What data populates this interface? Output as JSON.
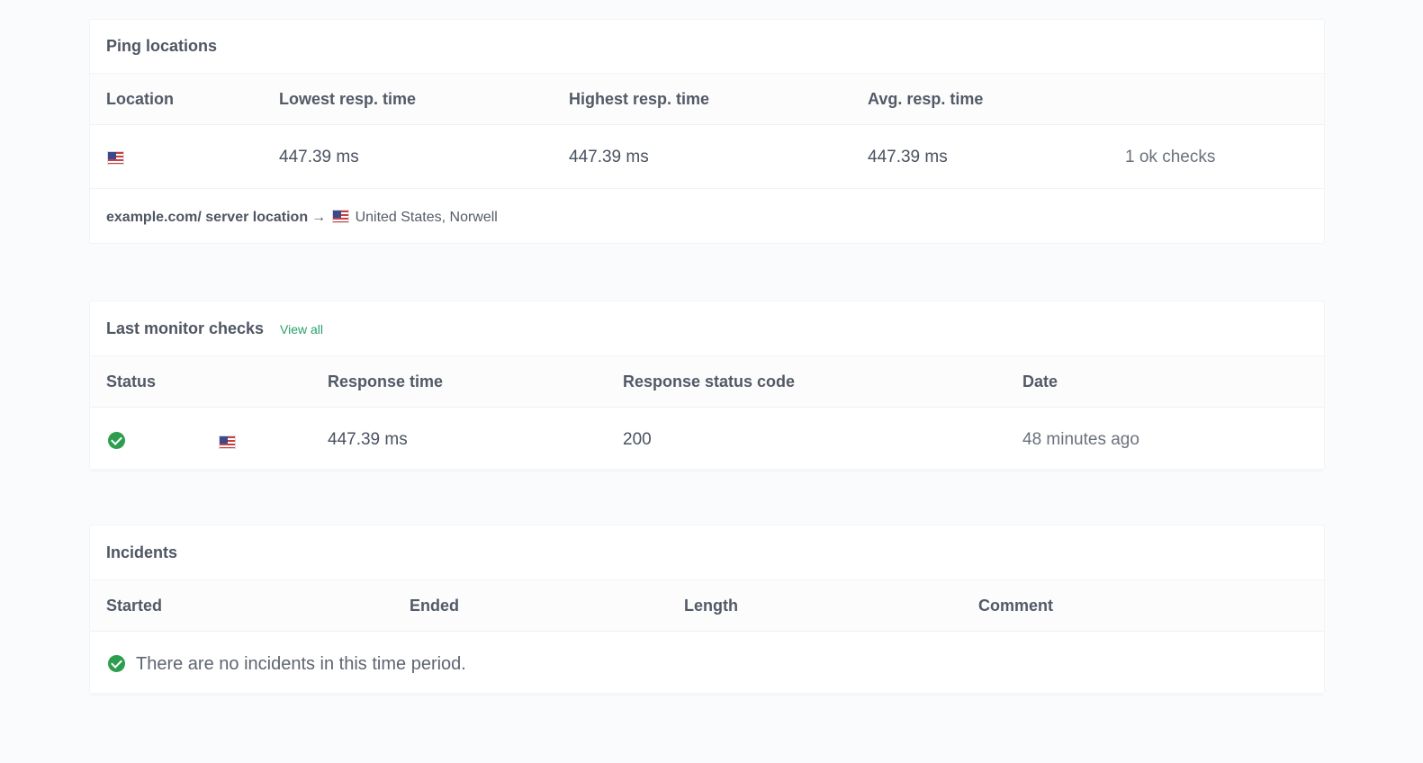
{
  "ping_locations": {
    "title": "Ping locations",
    "columns": [
      "Location",
      "Lowest resp. time",
      "Highest resp. time",
      "Avg. resp. time"
    ],
    "rows": [
      {
        "location_icon": "us-flag-icon",
        "lowest": "447.39 ms",
        "highest": "447.39 ms",
        "avg": "447.39 ms",
        "checks": "1 ok checks"
      }
    ],
    "server_label": "example.com/ server location",
    "arrow": "→",
    "server_location": "United States, Norwell"
  },
  "last_checks": {
    "title": "Last monitor checks",
    "view_all": "View all",
    "columns": [
      "Status",
      "Response time",
      "Response status code",
      "Date"
    ],
    "rows": [
      {
        "status_icon": "check-circle-icon",
        "location_icon": "us-flag-icon",
        "response_time": "447.39 ms",
        "status_code": "200",
        "date": "48 minutes ago"
      }
    ]
  },
  "incidents": {
    "title": "Incidents",
    "columns": [
      "Started",
      "Ended",
      "Length",
      "Comment"
    ],
    "empty_icon": "check-circle-icon",
    "empty_message": "There are no incidents in this time period."
  },
  "colors": {
    "background": "#fafbfd",
    "card": "#ffffff",
    "success": "#2d9e4f",
    "link": "#2aa06b",
    "flag_red": "#c94040",
    "flag_blue": "#3c4a8c"
  }
}
